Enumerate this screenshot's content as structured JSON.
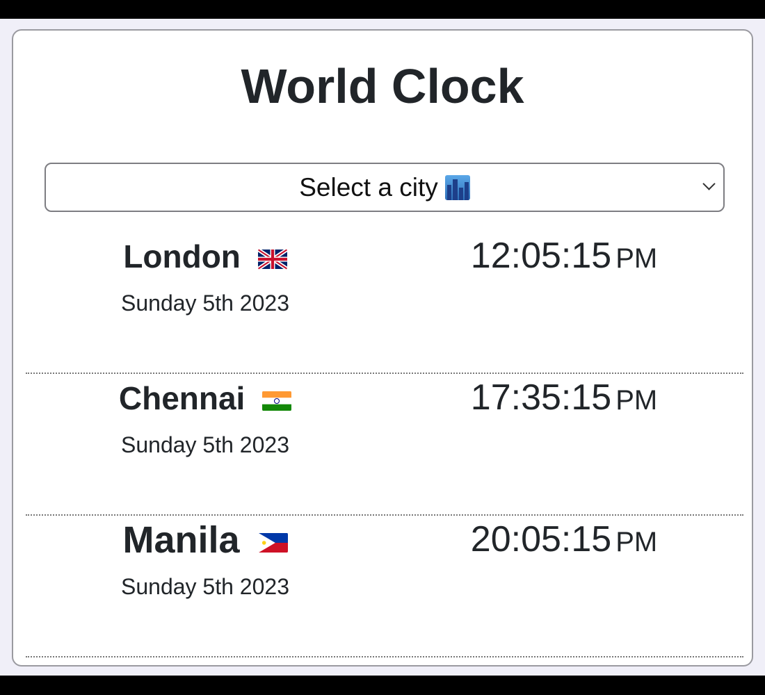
{
  "app": {
    "title": "World Clock"
  },
  "city_select": {
    "placeholder": "Select a city",
    "icon": "cityscape-icon"
  },
  "cities": [
    {
      "name": "London",
      "flag": "uk-flag-icon",
      "date": "Sunday 5th 2023",
      "time": "12:05:15",
      "ampm": "PM"
    },
    {
      "name": "Chennai",
      "flag": "india-flag-icon",
      "date": "Sunday 5th 2023",
      "time": "17:35:15",
      "ampm": "PM"
    },
    {
      "name": "Manila",
      "flag": "philippines-flag-icon",
      "date": "Sunday 5th 2023",
      "time": "20:05:15",
      "ampm": "PM"
    }
  ],
  "colors": {
    "text": "#212529",
    "background": "#f0eff8",
    "card": "#ffffff",
    "border": "#9a9aa0"
  }
}
